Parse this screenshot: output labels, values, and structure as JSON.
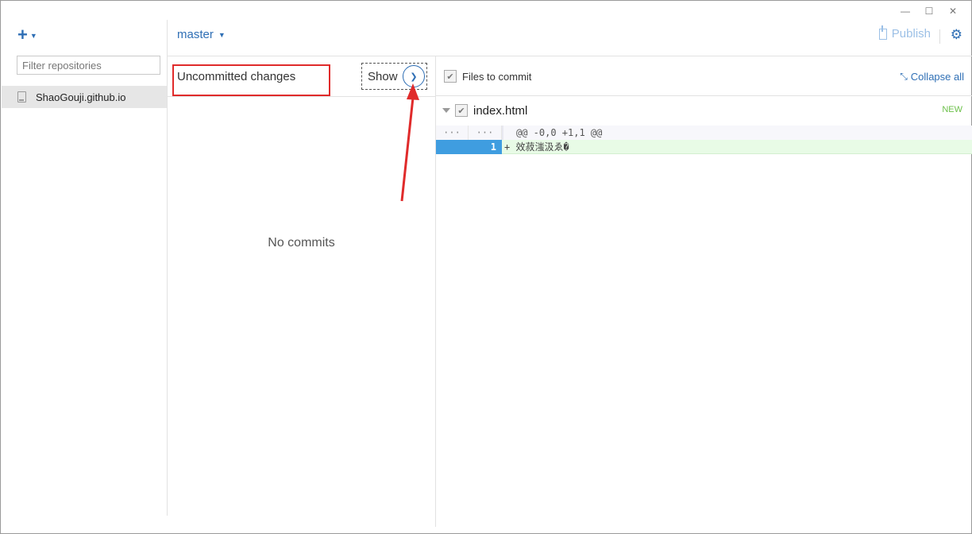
{
  "window": {
    "controls": [
      "—",
      "☐",
      "✕"
    ]
  },
  "sidebar": {
    "add_label": "+",
    "filter_placeholder": "Filter repositories",
    "repositories": [
      {
        "name": "ShaoGouji.github.io"
      }
    ]
  },
  "topbar": {
    "branch": "master",
    "publish_label": "Publish"
  },
  "history": {
    "uncommitted_label": "Uncommitted changes",
    "show_label": "Show",
    "empty_label": "No commits"
  },
  "changes": {
    "files_to_commit_label": "Files to commit",
    "collapse_all_label": "Collapse all",
    "files": [
      {
        "name": "index.html",
        "badge": "NEW",
        "hunk": {
          "old_gutter": "···",
          "new_gutter": "···",
          "header": "@@ -0,0 +1,1 @@"
        },
        "lines": [
          {
            "old": "",
            "new": "1",
            "text": "+ 效菽滍汲ゑ�"
          }
        ]
      }
    ]
  },
  "colors": {
    "accent": "#2f6fb5",
    "annotation_red": "#e02b2b",
    "added_line_bg": "#e8fbe6",
    "new_badge": "#6cc04a"
  },
  "icons": {
    "add": "plus-icon",
    "repo": "repo-book-icon",
    "publish": "publish-icon",
    "settings": "gear-icon",
    "show": "chevron-down-icon",
    "collapse": "collapse-arrows-icon"
  }
}
